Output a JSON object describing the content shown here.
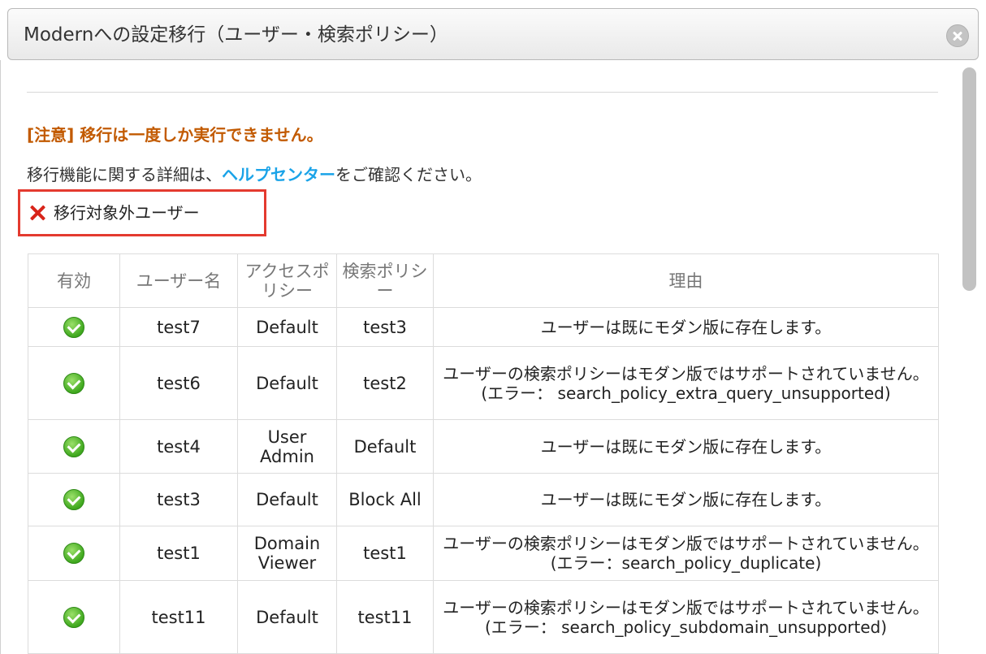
{
  "dialog": {
    "title": "Modernへの設定移行（ユーザー・検索ポリシー）"
  },
  "warning": "[注意] 移行は一度しか実行できません。",
  "info": {
    "prefix": "移行機能に関する詳細は、",
    "link": "ヘルプセンター",
    "suffix": "をご確認ください。"
  },
  "excluded_section": {
    "label": "移行対象外ユーザー",
    "icon": "x-icon"
  },
  "table": {
    "headers": [
      "有効",
      "ユーザー名",
      "アクセスポリシー",
      "検索ポリシー",
      "理由"
    ],
    "rows": [
      {
        "enabled": "check-circle-icon",
        "user": "test7",
        "access": "Default",
        "search": "test3",
        "reason": "ユーザーは既にモダン版に存在します。"
      },
      {
        "enabled": "check-circle-icon",
        "user": "test6",
        "access": "Default",
        "search": "test2",
        "reason": "ユーザーの検索ポリシーはモダン版ではサポートされていません。 (エラー： search_policy_extra_query_unsupported)"
      },
      {
        "enabled": "check-circle-icon",
        "user": "test4",
        "access": "User Admin",
        "search": "Default",
        "reason": "ユーザーは既にモダン版に存在します。"
      },
      {
        "enabled": "check-circle-icon",
        "user": "test3",
        "access": "Default",
        "search": "Block All",
        "reason": "ユーザーは既にモダン版に存在します。"
      },
      {
        "enabled": "check-circle-icon",
        "user": "test1",
        "access": "Domain Viewer",
        "search": "test1",
        "reason": "ユーザーの検索ポリシーはモダン版ではサポートされていません。 (エラー：search_policy_duplicate)"
      },
      {
        "enabled": "check-circle-icon",
        "user": "test11",
        "access": "Default",
        "search": "test11",
        "reason": "ユーザーの検索ポリシーはモダン版ではサポートされていません。 (エラー： search_policy_subdomain_unsupported)"
      }
    ]
  },
  "colors": {
    "warning": "#c25a00",
    "link": "#1aa3e8",
    "highlight_border": "#e43a2f",
    "ok": "#3fa81e"
  }
}
